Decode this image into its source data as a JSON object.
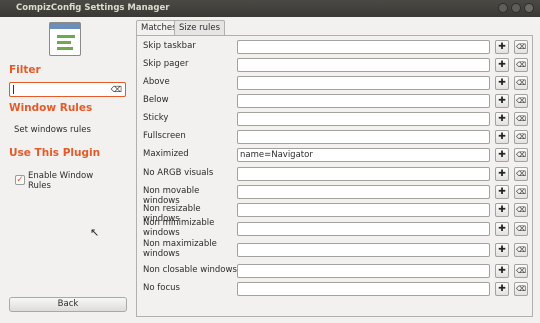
{
  "window": {
    "title": "CompizConfig Settings Manager"
  },
  "sidebar": {
    "filter_heading": "Filter",
    "filter_value": "",
    "plugin_heading": "Window Rules",
    "plugin_link": "Set windows rules",
    "use_heading": "Use This Plugin",
    "enable_label": "Enable Window Rules",
    "enable_checked": true,
    "back_label": "Back"
  },
  "tabs": [
    {
      "label": "Matches",
      "active": true
    },
    {
      "label": "Size rules",
      "active": false
    }
  ],
  "rows": [
    {
      "label": "Skip taskbar",
      "value": ""
    },
    {
      "label": "Skip pager",
      "value": ""
    },
    {
      "label": "Above",
      "value": ""
    },
    {
      "label": "Below",
      "value": ""
    },
    {
      "label": "Sticky",
      "value": ""
    },
    {
      "label": "Fullscreen",
      "value": ""
    },
    {
      "label": "Maximized",
      "value": "name=Navigator"
    },
    {
      "label": "No ARGB visuals",
      "value": ""
    },
    {
      "label": "Non movable windows",
      "value": ""
    },
    {
      "label": "Non resizable windows",
      "value": ""
    },
    {
      "label": "Non minimizable windows",
      "value": ""
    },
    {
      "label": "Non maximizable windows",
      "value": ""
    },
    {
      "label": "Non closable windows",
      "value": ""
    },
    {
      "label": "No focus",
      "value": ""
    }
  ],
  "icons": {
    "add": "plus-icon",
    "clear": "clear-icon"
  }
}
